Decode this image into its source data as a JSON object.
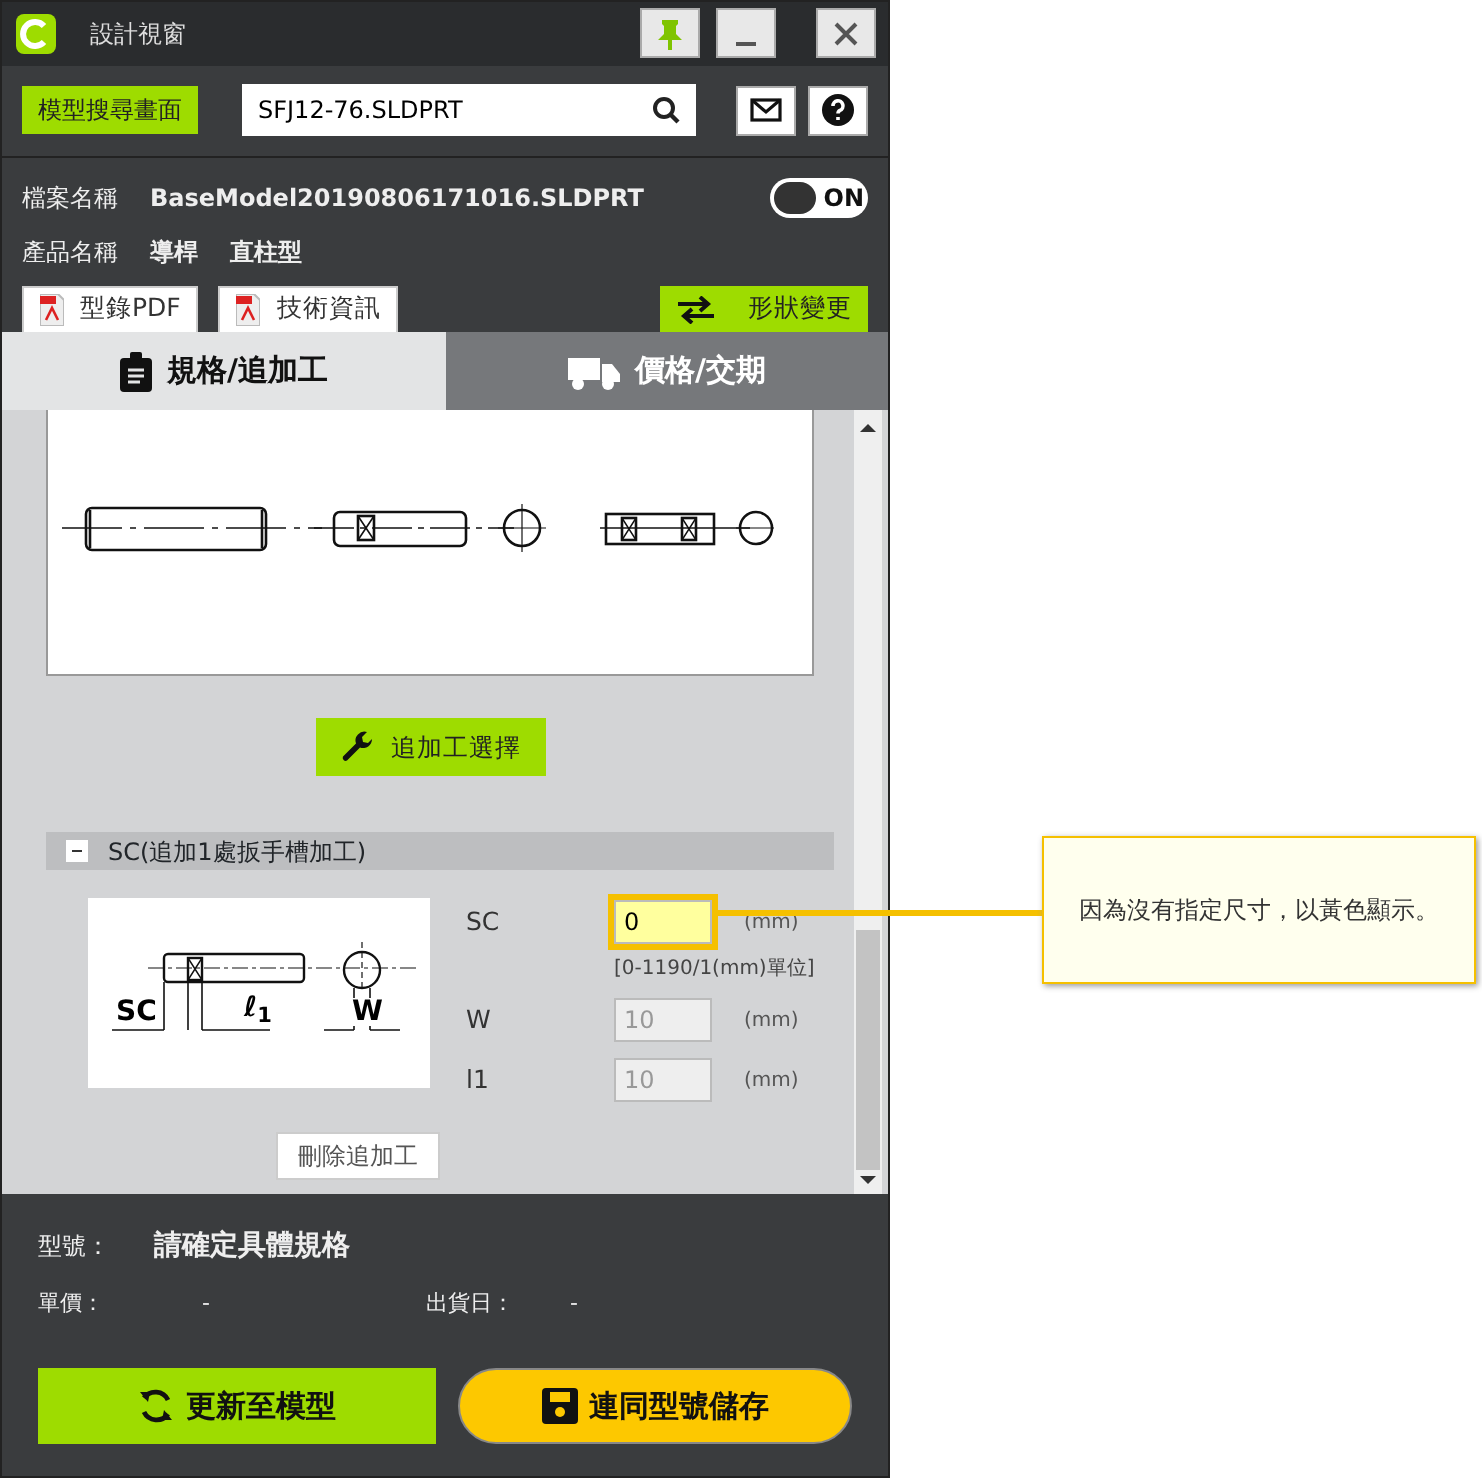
{
  "window": {
    "title": "設計視窗"
  },
  "toolbar": {
    "search_screen_button": "模型搜尋畫面",
    "search": {
      "value": "SFJ12-76.SLDPRT"
    }
  },
  "file": {
    "label": "檔案名稱",
    "value": "BaseModel20190806171016.SLDPRT",
    "toggle": {
      "on": true,
      "label": "ON"
    }
  },
  "product": {
    "label": "產品名稱",
    "values": [
      "導桿",
      "直柱型"
    ]
  },
  "doc_buttons": [
    "型錄PDF",
    "技術資訊"
  ],
  "shape_change_button": "形狀變更",
  "tabs": [
    {
      "label": "規格/追加工",
      "selected": true,
      "kind": "spec"
    },
    {
      "label": "價格/交期",
      "selected": false,
      "kind": "price"
    }
  ],
  "add_process_button": "追加工選擇",
  "section": {
    "title": "SC(追加1處扳手槽加工)",
    "expanded": true,
    "diagram_labels": [
      "SC",
      "ℓ$_{1}$",
      "W"
    ],
    "fields": [
      {
        "label": "SC",
        "value": "0",
        "unit": "(mm)",
        "hint": "[0-1190/1(mm)單位]",
        "highlighted": true,
        "disabled": false
      },
      {
        "label": "W",
        "value": "10",
        "unit": "(mm)",
        "highlighted": false,
        "disabled": true
      },
      {
        "label": "l1",
        "value": "10",
        "unit": "(mm)",
        "highlighted": false,
        "disabled": true
      }
    ],
    "delete_button": "刪除追加工"
  },
  "summary": {
    "model_label": "型號：",
    "model_value": "請確定具體規格",
    "price_label": "單價：",
    "price_value": "-",
    "ship_label": "出貨日：",
    "ship_value": "-"
  },
  "actions": [
    {
      "label": "更新至模型",
      "kind": "update"
    },
    {
      "label": "連同型號儲存",
      "kind": "save"
    }
  ],
  "callout": {
    "text": "因為沒有指定尺寸，以黃色顯示。"
  }
}
